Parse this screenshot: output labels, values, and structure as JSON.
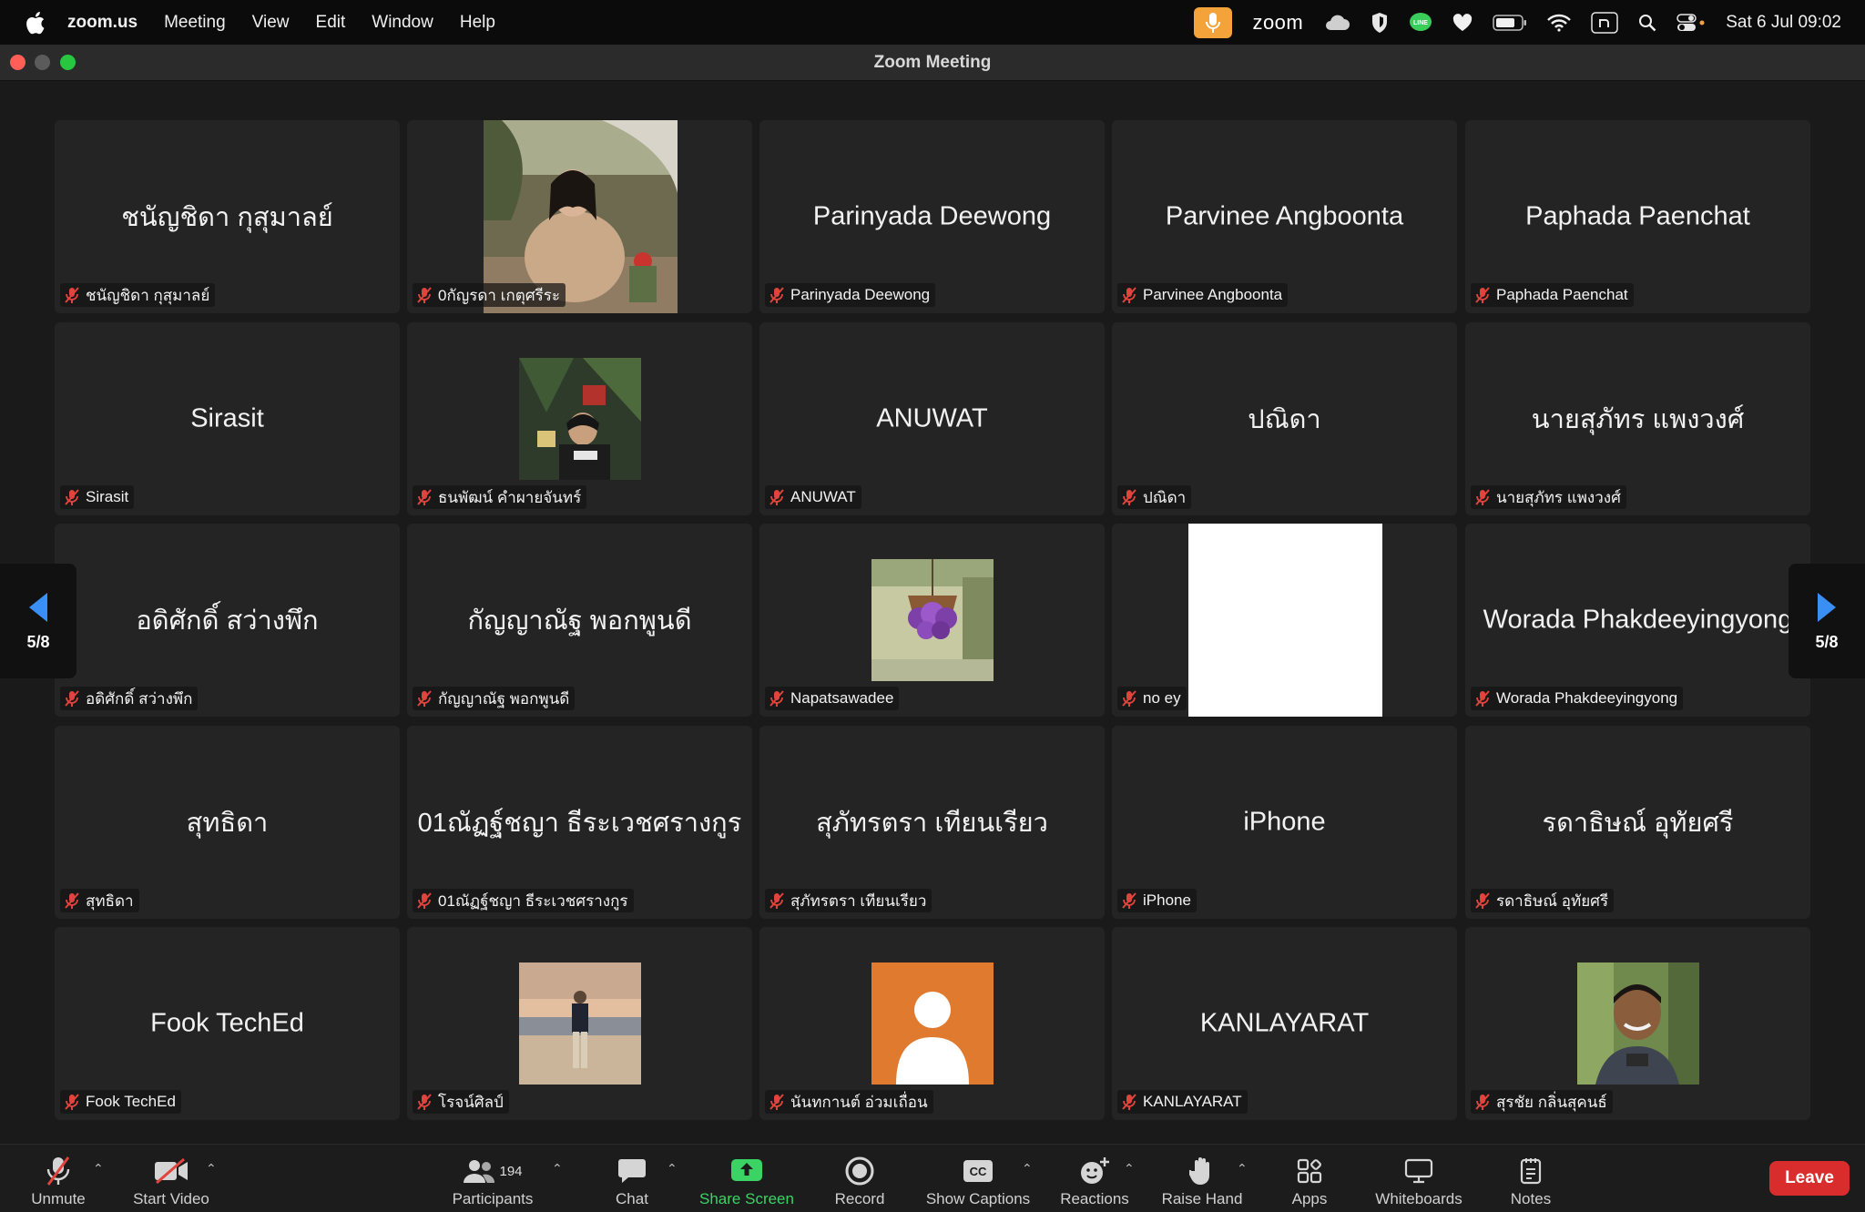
{
  "menubar": {
    "app": "zoom.us",
    "items": [
      "Meeting",
      "View",
      "Edit",
      "Window",
      "Help"
    ],
    "tray_brand": "zoom",
    "clock": "Sat 6 Jul  09:02"
  },
  "window": {
    "title": "Zoom Meeting"
  },
  "grid": {
    "page_left": "5/8",
    "page_right": "5/8",
    "tiles": [
      {
        "display": "ชนัญชิดา กุสุมาลย์",
        "label": "ชนัญชิดา กุสุมาลย์"
      },
      {
        "display": "",
        "label": "0กัญรดา เกตุศรีระ"
      },
      {
        "display": "Parinyada Deewong",
        "label": "Parinyada Deewong"
      },
      {
        "display": "Parvinee Angboonta",
        "label": "Parvinee Angboonta"
      },
      {
        "display": "Paphada Paenchat",
        "label": "Paphada Paenchat"
      },
      {
        "display": "Sirasit",
        "label": "Sirasit"
      },
      {
        "display": "",
        "label": "ธนพัฒน์ คำผายจันทร์"
      },
      {
        "display": "ANUWAT",
        "label": "ANUWAT"
      },
      {
        "display": "ปณิดา",
        "label": "ปณิดา"
      },
      {
        "display": "นายสุภัทร แพงวงศ์",
        "label": "นายสุภัทร แพงวงศ์"
      },
      {
        "display": "อดิศักดิ์ สว่างพึก",
        "label": "อดิศักดิ์ สว่างพึก"
      },
      {
        "display": "กัญญาณัฐ พอกพูนดี",
        "label": "กัญญาณัฐ พอกพูนดี"
      },
      {
        "display": "",
        "label": "Napatsawadee"
      },
      {
        "display": "",
        "label": "no ey"
      },
      {
        "display": "Worada Phakdeeyingyong",
        "label": "Worada Phakdeeyingyong"
      },
      {
        "display": "สุทธิดา",
        "label": "สุทธิดา"
      },
      {
        "display": "01ณัฏฐ์ชญา ธีระเวชศรางกูร",
        "label": "01ณัฏฐ์ชญา ธีระเวชศรางกูร"
      },
      {
        "display": "สุภัทรตรา เทียนเรียว",
        "label": "สุภัทรตรา เทียนเรียว"
      },
      {
        "display": "iPhone",
        "label": "iPhone"
      },
      {
        "display": "รดาธิษณ์ อุทัยศรี",
        "label": "รดาธิษณ์ อุทัยศรี"
      },
      {
        "display": "Fook TechEd",
        "label": "Fook TechEd"
      },
      {
        "display": "",
        "label": "โรจน์ศิลป์"
      },
      {
        "display": "",
        "label": "นันทกานต์ อ่วมเถื่อน"
      },
      {
        "display": "KANLAYARAT",
        "label": "KANLAYARAT"
      },
      {
        "display": "",
        "label": "สุรชัย กลิ่นสุคนธ์"
      }
    ]
  },
  "toolbar": {
    "unmute": "Unmute",
    "start_video": "Start Video",
    "participants": "Participants",
    "participants_count": "194",
    "chat": "Chat",
    "share_screen": "Share Screen",
    "record": "Record",
    "show_captions": "Show Captions",
    "captions_badge": "CC",
    "reactions": "Reactions",
    "raise_hand": "Raise Hand",
    "apps": "Apps",
    "whiteboards": "Whiteboards",
    "notes": "Notes",
    "leave": "Leave"
  },
  "colors": {
    "accent_green": "#3bd363",
    "leave_red": "#d92d2d",
    "mic_tray_orange": "#f3a33a",
    "pager_blue": "#3a8ff5",
    "muted_red": "#e0443c"
  }
}
